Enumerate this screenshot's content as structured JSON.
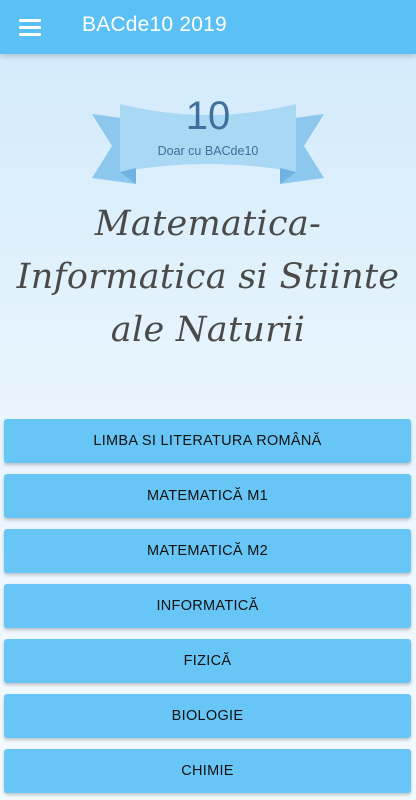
{
  "appbar": {
    "menu_icon": "hamburger-menu-icon",
    "title": "BACde10 2019",
    "color": "#5bc0f5"
  },
  "badge": {
    "number": "10",
    "caption": "Doar cu BACde10",
    "ribbon_color": "#a9d8f5",
    "text_color": "#3f6f9a"
  },
  "profile": {
    "line1": "Matematica-",
    "line2": "Informatica si Stiinte",
    "line3": "ale Naturii"
  },
  "subjects": [
    {
      "label": "LIMBA SI LITERATURA ROMÂNĂ"
    },
    {
      "label": "MATEMATICĂ M1"
    },
    {
      "label": "MATEMATICĂ M2"
    },
    {
      "label": "INFORMATICĂ"
    },
    {
      "label": "FIZICĂ"
    },
    {
      "label": "BIOLOGIE"
    },
    {
      "label": "CHIMIE"
    }
  ],
  "button_color": "#67c6f6"
}
